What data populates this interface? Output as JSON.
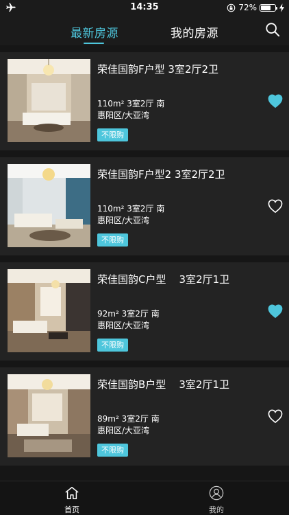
{
  "status_bar": {
    "time": "14:35",
    "battery_percent_text": "72%",
    "battery_level": 0.72
  },
  "header": {
    "tabs": [
      {
        "label": "最新房源",
        "active": true
      },
      {
        "label": "我的房源",
        "active": false
      }
    ]
  },
  "listings": [
    {
      "title": "荣佳国韵F户型 3室2厅2卫",
      "area": "110m²",
      "specs": "3室2厅 南",
      "region": "惠阳区/大亚湾",
      "tag": "不限购",
      "favorited": true
    },
    {
      "title": "荣佳国韵F户型2 3室2厅2卫",
      "area": "110m²",
      "specs": "3室2厅 南",
      "region": "惠阳区/大亚湾",
      "tag": "不限购",
      "favorited": false
    },
    {
      "title": "荣佳国韵C户型    3室2厅1卫",
      "area": "92m²",
      "specs": "3室2厅 南",
      "region": "惠阳区/大亚湾",
      "tag": "不限购",
      "favorited": true
    },
    {
      "title": "荣佳国韵B户型    3室2厅1卫",
      "area": "89m²",
      "specs": "3室2厅 南",
      "region": "惠阳区/大亚湾",
      "tag": "不限购",
      "favorited": false
    }
  ],
  "tabbar": {
    "home_label": "首页",
    "mine_label": "我的"
  },
  "colors": {
    "accent": "#4ec6dc",
    "background": "#1b1b1b",
    "card": "#232323"
  },
  "icons": {
    "status_left": "airplane-icon",
    "search": "search-icon",
    "favorite": "heart-icon",
    "home": "home-icon",
    "mine": "user-icon"
  }
}
